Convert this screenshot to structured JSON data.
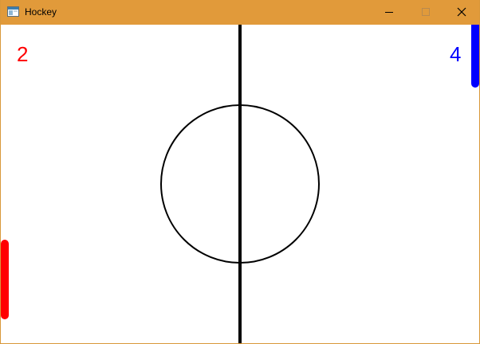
{
  "window": {
    "title": "Hockey",
    "titlebar_color": "#e19a3a",
    "border_color": "#d9983a",
    "icons": {
      "app": "application-window-icon",
      "minimize": "minimize-icon",
      "maximize": "maximize-icon",
      "close": "close-icon"
    }
  },
  "game": {
    "background_color": "#ffffff",
    "line_color": "#000000",
    "left_player": {
      "score": "2",
      "color": "#ff0000"
    },
    "right_player": {
      "score": "4",
      "color": "#0000ff"
    }
  }
}
